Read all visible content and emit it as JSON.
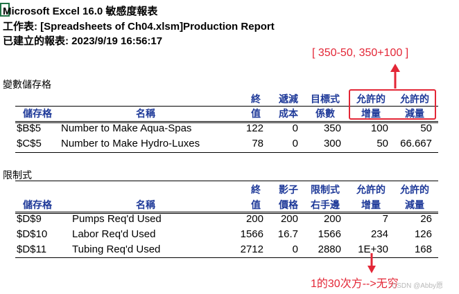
{
  "header": {
    "app_line": "Microsoft Excel 16.0 敏感度報表",
    "sheet_line": "工作表: [Spreadsheets of Ch04.xlsm]Production Report",
    "created_line": "已建立的報表: 2023/9/19 16:56:17",
    "active_cell_char": "M"
  },
  "variables": {
    "section_title": "變數儲存格",
    "headers": {
      "cell": "儲存格",
      "name": "名稱",
      "final_value": [
        "終",
        "值"
      ],
      "reduced_cost": [
        "遞減",
        "成本"
      ],
      "objective_coef": [
        "目標式",
        "係數"
      ],
      "allow_increase": [
        "允許的",
        "增量"
      ],
      "allow_decrease": [
        "允許的",
        "減量"
      ]
    },
    "rows": [
      {
        "cell": "$B$5",
        "name": "Number to Make Aqua-Spas",
        "final": "122",
        "reduced": "0",
        "coef": "350",
        "inc": "100",
        "dec": "50"
      },
      {
        "cell": "$C$5",
        "name": "Number to Make Hydro-Luxes",
        "final": "78",
        "reduced": "0",
        "coef": "300",
        "inc": "50",
        "dec": "66.667"
      }
    ]
  },
  "constraints": {
    "section_title": "限制式",
    "headers": {
      "cell": "儲存格",
      "name": "名稱",
      "final_value": [
        "終",
        "值"
      ],
      "shadow_price": [
        "影子",
        "價格"
      ],
      "rhs": [
        "限制式",
        "右手邊"
      ],
      "allow_increase": [
        "允許的",
        "增量"
      ],
      "allow_decrease": [
        "允許的",
        "減量"
      ]
    },
    "rows": [
      {
        "cell": "$D$9",
        "name": "Pumps Req'd Used",
        "final": "200",
        "shadow": "200",
        "rhs": "200",
        "inc": "7",
        "dec": "26"
      },
      {
        "cell": "$D$10",
        "name": "Labor Req'd Used",
        "final": "1566",
        "shadow": "16.7",
        "rhs": "1566",
        "inc": "234",
        "dec": "126"
      },
      {
        "cell": "$D$11",
        "name": "Tubing Req'd Used",
        "final": "2712",
        "shadow": "0",
        "rhs": "2880",
        "inc": "1E+30",
        "dec": "168"
      }
    ]
  },
  "annotations": {
    "range_note": "[ 350-50, 350+100 ]",
    "infinity_note": "1的30次方-->无穷",
    "watermark": "CSDN @Abby愿",
    "accent_color": "#e32636"
  }
}
